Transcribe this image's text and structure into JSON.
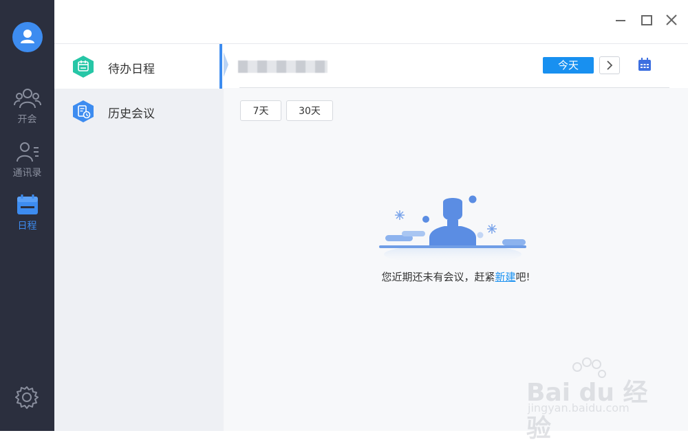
{
  "rail": {
    "items": [
      {
        "label": "开会",
        "icon": "group-icon"
      },
      {
        "label": "通讯录",
        "icon": "contacts-icon"
      },
      {
        "label": "日程",
        "icon": "calendar-icon",
        "active": true
      }
    ],
    "settings_icon": "gear-icon"
  },
  "window": {
    "minimize_icon": "minimize-icon",
    "maximize_icon": "maximize-icon",
    "close_icon": "close-icon"
  },
  "subnav": {
    "items": [
      {
        "label": "待办日程",
        "icon": "calendar-hex-icon",
        "color": "#26c6a6",
        "active": true
      },
      {
        "label": "历史会议",
        "icon": "history-hex-icon",
        "color": "#3d8cf0"
      }
    ]
  },
  "toolbar": {
    "today_label": "今天",
    "next_icon": "chevron-right-icon",
    "calendar_icon": "calendar-icon"
  },
  "range_filters": [
    "7天",
    "30天"
  ],
  "empty_state": {
    "message_prefix": "您近期还未有会议，赶紧",
    "link_label": "新建",
    "message_suffix": "吧!"
  },
  "watermark": {
    "brand": "Bai du 经验",
    "url": "jingyan.baidu.com"
  },
  "colors": {
    "accent": "#1890f0",
    "rail_bg": "#2b2f3e",
    "subnav_bg": "#eef0f4"
  }
}
